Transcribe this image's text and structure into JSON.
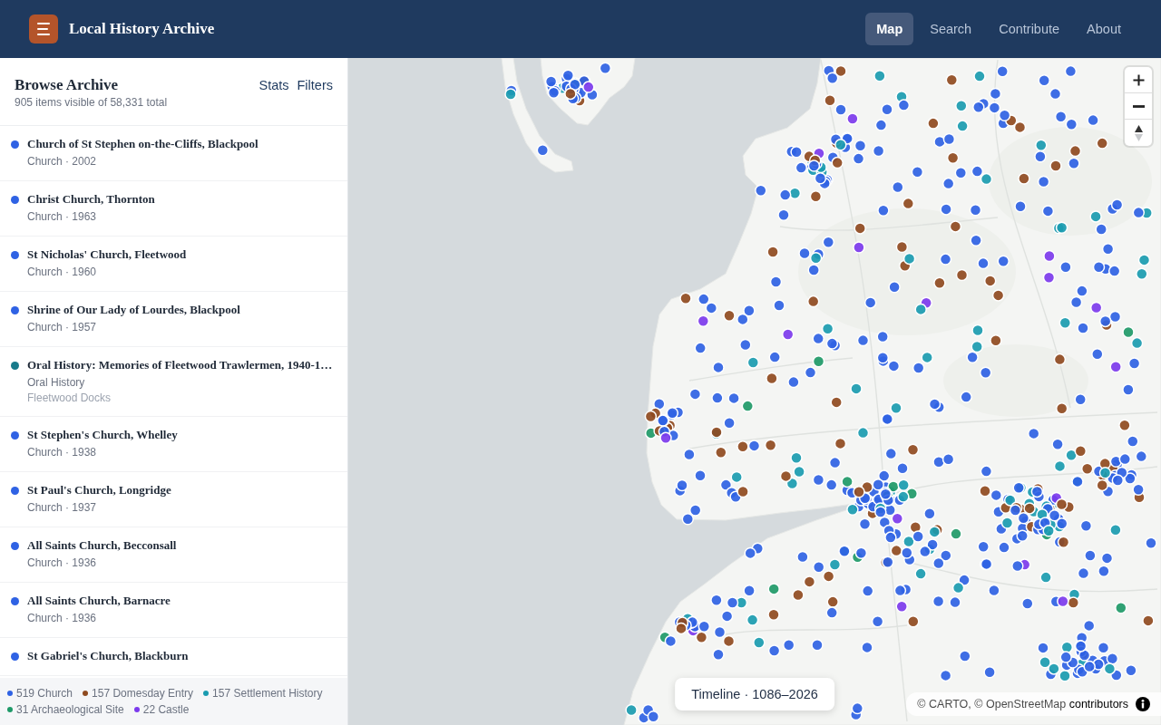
{
  "header": {
    "title": "Local History Archive",
    "nav": [
      {
        "label": "Map",
        "selected": true
      },
      {
        "label": "Search",
        "selected": false
      },
      {
        "label": "Contribute",
        "selected": false
      },
      {
        "label": "About",
        "selected": false
      }
    ]
  },
  "sidebar": {
    "title": "Browse Archive",
    "actions": [
      "Stats",
      "Filters"
    ],
    "summary": "905 items visible of 58,331 total",
    "items": [
      {
        "title": "Church of St Stephen on-the-Cliffs, Blackpool",
        "meta": "Church · 2002",
        "color": "#2f62e4"
      },
      {
        "title": "Christ Church, Thornton",
        "meta": "Church · 1963",
        "color": "#2f62e4"
      },
      {
        "title": "St Nicholas' Church, Fleetwood",
        "meta": "Church · 1960",
        "color": "#2f62e4"
      },
      {
        "title": "Shrine of Our Lady of Lourdes, Blackpool",
        "meta": "Church · 1957",
        "color": "#2f62e4"
      },
      {
        "title": "Oral History: Memories of Fleetwood Trawlermen, 1940-1…",
        "meta": "Oral History",
        "place": "Fleetwood Docks",
        "color": "#177a8a"
      },
      {
        "title": "St Stephen's Church, Whelley",
        "meta": "Church · 1938",
        "color": "#2f62e4"
      },
      {
        "title": "St Paul's Church, Longridge",
        "meta": "Church · 1937",
        "color": "#2f62e4"
      },
      {
        "title": "All Saints Church, Becconsall",
        "meta": "Church · 1936",
        "color": "#2f62e4"
      },
      {
        "title": "All Saints Church, Barnacre",
        "meta": "Church · 1936",
        "color": "#2f62e4"
      },
      {
        "title": "St Gabriel's Church, Blackburn",
        "color": "#2f62e4"
      }
    ],
    "legend": [
      {
        "label": "519 Church",
        "color": "#2f62e4"
      },
      {
        "label": "157 Domesday Entry",
        "color": "#8f4a1f"
      },
      {
        "label": "157 Settlement History",
        "color": "#1a9bb0"
      },
      {
        "label": "31 Archaeological Site",
        "color": "#1e9968"
      },
      {
        "label": "22 Castle",
        "color": "#7c3aed"
      }
    ]
  },
  "map": {
    "timeline": "Timeline · 1086–2026",
    "attribution": {
      "text": "© CARTO, © OpenStreetMap",
      "link": "contributors"
    }
  }
}
